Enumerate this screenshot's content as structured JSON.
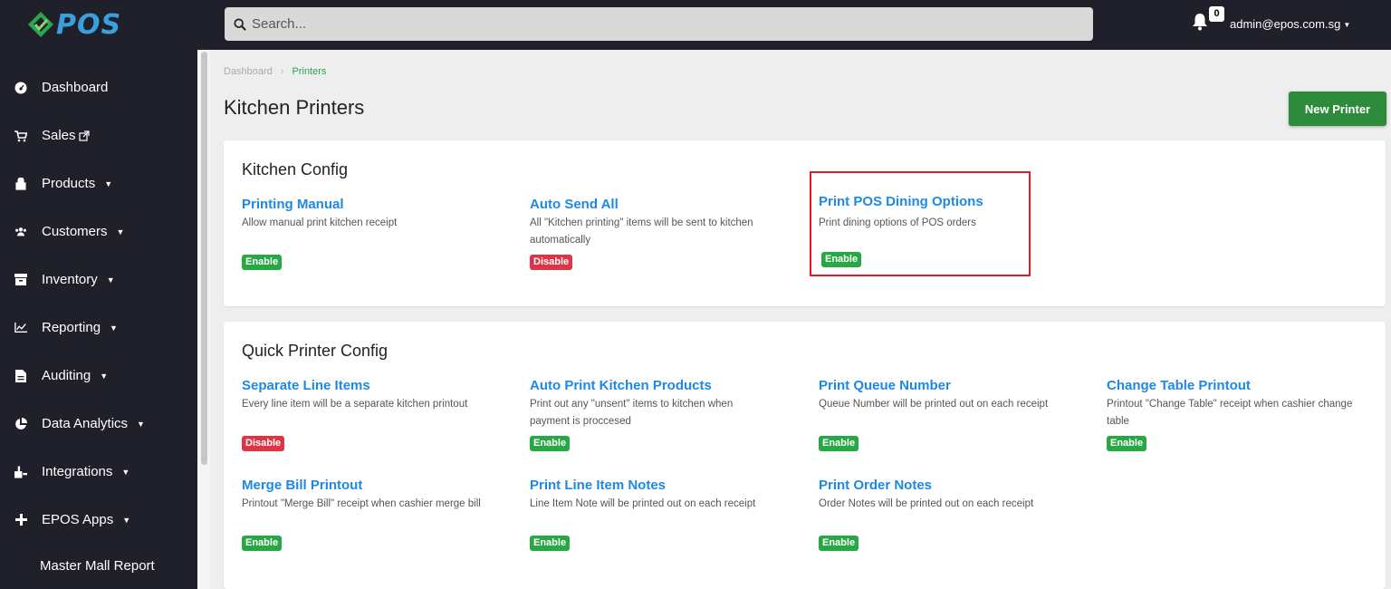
{
  "app": {
    "logo_text": "POS",
    "search_placeholder": "Search...",
    "notification_count": "0",
    "user_email": "admin@epos.com.sg",
    "brand_color": "#39a0e0",
    "accent_green": "#2e8b3c"
  },
  "sidebar": {
    "items": [
      {
        "label": "Dashboard",
        "icon": "dashboard-icon",
        "caret": false
      },
      {
        "label": "Sales",
        "icon": "cart-icon",
        "caret": false,
        "external": true
      },
      {
        "label": "Products",
        "icon": "products-icon",
        "caret": true
      },
      {
        "label": "Customers",
        "icon": "users-icon",
        "caret": true
      },
      {
        "label": "Inventory",
        "icon": "inventory-icon",
        "caret": true
      },
      {
        "label": "Reporting",
        "icon": "chart-icon",
        "caret": true
      },
      {
        "label": "Auditing",
        "icon": "file-icon",
        "caret": true
      },
      {
        "label": "Data Analytics",
        "icon": "pie-icon",
        "caret": true
      },
      {
        "label": "Integrations",
        "icon": "integrations-icon",
        "caret": true
      },
      {
        "label": "EPOS Apps",
        "icon": "plus-icon",
        "caret": true
      }
    ],
    "sub_item": "Master Mall Report"
  },
  "breadcrumb": {
    "root": "Dashboard",
    "current": "Printers"
  },
  "page": {
    "title": "Kitchen Printers",
    "new_button": "New Printer"
  },
  "kitchen_config": {
    "title": "Kitchen Config",
    "options": [
      {
        "title": "Printing Manual",
        "desc": "Allow manual print kitchen receipt",
        "status": "Enable"
      },
      {
        "title": "Auto Send All",
        "desc": "All \"Kitchen printing\" items will be sent to kitchen automatically",
        "status": "Disable"
      },
      {
        "title": "Print POS Dining Options",
        "desc": "Print dining options of POS orders",
        "status": "Enable"
      }
    ]
  },
  "quick_config": {
    "title": "Quick Printer Config",
    "options": [
      {
        "title": "Separate Line Items",
        "desc": "Every line item will be a separate kitchen printout",
        "status": "Disable"
      },
      {
        "title": "Auto Print Kitchen Products",
        "desc": "Print out any \"unsent\" items to kitchen when payment is proccesed",
        "status": "Enable"
      },
      {
        "title": "Print Queue Number",
        "desc": "Queue Number will be printed out on each receipt",
        "status": "Enable"
      },
      {
        "title": "Change Table Printout",
        "desc": "Printout \"Change Table\" receipt when cashier change table",
        "status": "Enable"
      },
      {
        "title": "Merge Bill Printout",
        "desc": "Printout \"Merge Bill\" receipt when cashier merge bill",
        "status": "Enable"
      },
      {
        "title": "Print Line Item Notes",
        "desc": "Line Item Note will be printed out on each receipt",
        "status": "Enable"
      },
      {
        "title": "Print Order Notes",
        "desc": "Order Notes will be printed out on each receipt",
        "status": "Enable"
      }
    ]
  }
}
